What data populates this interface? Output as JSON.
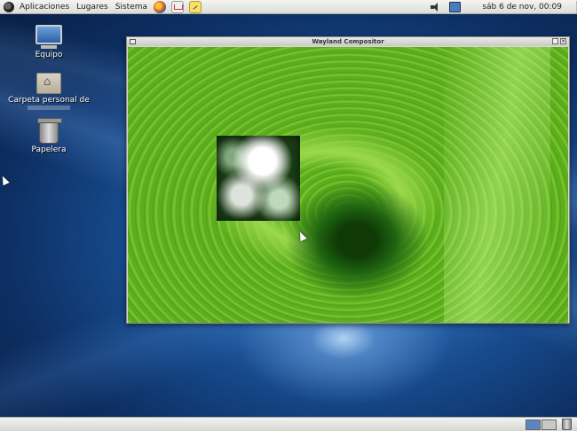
{
  "top_panel": {
    "menus": [
      "Aplicaciones",
      "Lugares",
      "Sistema"
    ],
    "clock": "sáb  6 de nov, 00:09",
    "launchers": [
      "firefox-icon",
      "mail-icon",
      "notes-icon"
    ]
  },
  "desktop": {
    "icons": [
      {
        "label": "Equipo",
        "icon": "computer-icon"
      },
      {
        "label": "Carpeta personal de",
        "icon": "home-folder-icon"
      },
      {
        "label": "Papelera",
        "icon": "trash-icon"
      }
    ]
  },
  "window": {
    "title": "Wayland Compositor"
  },
  "bottom_panel": {
    "workspaces": 2
  },
  "colors": {
    "desktop_blue": "#174a8c",
    "panel_bg": "#e6e6e3",
    "leaf_green": "#7cc832"
  }
}
